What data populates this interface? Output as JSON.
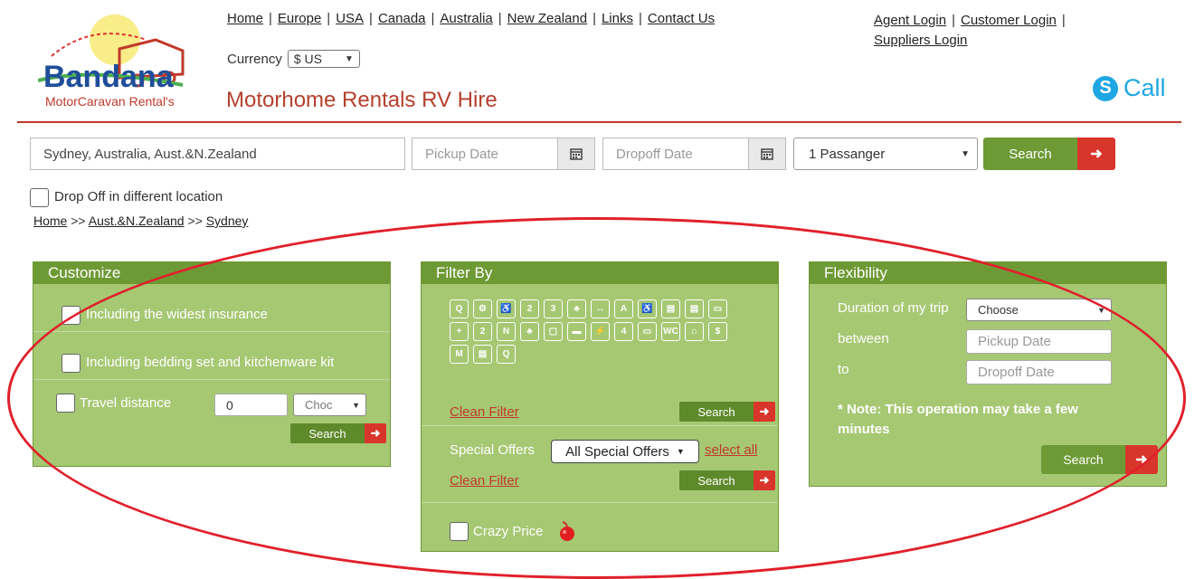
{
  "brand": {
    "logo_name": "Bandana",
    "logo_tagline": "MotorCaravan Rental's",
    "tagline": "Motorhome Rentals RV Hire",
    "accent": "#b5402d",
    "green": "#6e9a35",
    "panel_green": "#a6c873"
  },
  "nav": [
    "Home",
    "Europe",
    "USA",
    "Canada",
    "Australia",
    "New Zealand",
    "Links",
    "Contact Us"
  ],
  "account": {
    "agent": "Agent Login",
    "customer": "Customer Login",
    "suppliers": "Suppliers Login"
  },
  "currency": {
    "label": "Currency",
    "value": "$ US"
  },
  "skype": {
    "label": "Call",
    "icon": "skype-icon"
  },
  "search": {
    "location": "Sydney, Australia, Aust.&N.Zealand",
    "pickup_placeholder": "Pickup Date",
    "dropoff_placeholder": "Dropoff Date",
    "passengers": "1 Passanger",
    "button": "Search",
    "dropoff_different": "Drop Off in different location"
  },
  "breadcrumb": {
    "home": "Home",
    "sep": ">>",
    "region": "Aust.&N.Zealand",
    "city": "Sydney"
  },
  "customize": {
    "title": "Customize",
    "insurance": "Including the widest insurance",
    "bedding": "Including bedding set and kitchenware kit",
    "travel_distance": "Travel distance",
    "distance_value": "0",
    "distance_unit": "Choc",
    "button": "Search"
  },
  "filter": {
    "title": "Filter By",
    "icons": [
      "Q",
      "⚙",
      "♿",
      "2",
      "3",
      "♣",
      "↔",
      "A",
      "♿",
      "▤",
      "▤",
      "▭",
      "+",
      "2",
      "N",
      "♣",
      "▢",
      "▬",
      "⚡",
      "4",
      "▭",
      "WC",
      "⌂",
      "$",
      "M",
      "▤",
      "Q"
    ],
    "clean": "Clean Filter",
    "button": "Search",
    "special_label": "Special Offers",
    "special_value": "All Special Offers",
    "select_all": "select all",
    "clean2": "Clean Filter",
    "button2": "Search",
    "crazy": "Crazy Price"
  },
  "flex": {
    "title": "Flexibility",
    "duration": "Duration of my trip",
    "duration_value": "Choose",
    "between": "between",
    "to": "to",
    "pickup_placeholder": "Pickup Date",
    "dropoff_placeholder": "Dropoff Date",
    "note": "* Note: This operation may take a few minutes",
    "button": "Search"
  }
}
